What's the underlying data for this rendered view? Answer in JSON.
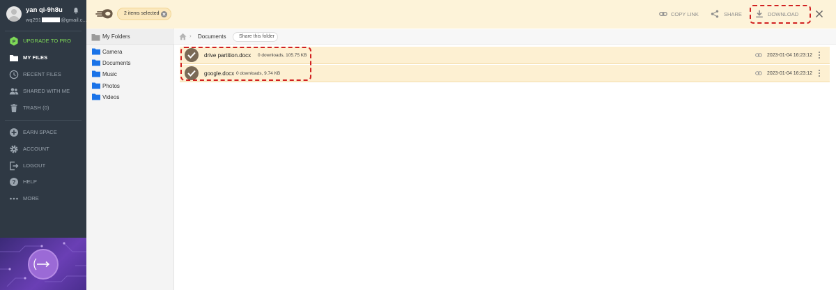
{
  "user": {
    "name": "yan qi-9h8u",
    "email_prefix": "wq291",
    "email_suffix": "@gmail.c..."
  },
  "nav": {
    "upgrade": "UPGRADE TO PRO",
    "my_files": "MY FILES",
    "recent": "RECENT FILES",
    "shared": "SHARED WITH ME",
    "trash": "TRASH (0)",
    "earn": "EARN SPACE",
    "account": "ACCOUNT",
    "logout": "LOGOUT",
    "help": "HELP",
    "more": "MORE"
  },
  "tree": {
    "root": "My Folders",
    "folders": [
      "Camera",
      "Documents",
      "Music",
      "Photos",
      "Videos"
    ]
  },
  "topbar": {
    "selection": "2 items selected",
    "copy_link": "COPY LINK",
    "share": "SHARE",
    "download": "DOWNLOAD"
  },
  "breadcrumb": {
    "current": "Documents",
    "share_folder": "Share this folder"
  },
  "files": [
    {
      "name": "drive partition.docx",
      "meta": "0 downloads, 105.75 KB",
      "date": "2023-01-04 16:23:12"
    },
    {
      "name": "google.docx",
      "meta": "0 downloads, 9.74 KB",
      "date": "2023-01-04 16:23:12"
    }
  ],
  "colors": {
    "sidebar_bg": "#2f3944",
    "accent_bar": "#fdf3d9",
    "selected_row": "#fdf0d2",
    "pro_green": "#7ed957",
    "folder_blue": "#1a73e8",
    "annotation_red": "#d12020"
  }
}
